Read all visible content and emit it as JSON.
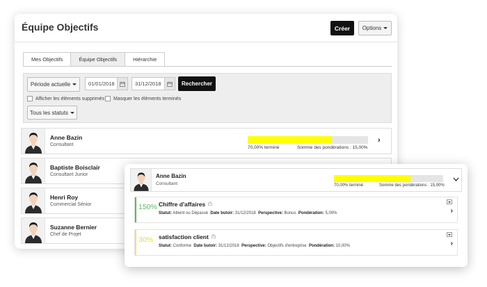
{
  "header": {
    "title": "Équipe Objectifs",
    "create_label": "Créer",
    "options_label": "Options"
  },
  "tabs": [
    {
      "label": "Mes Objectifs",
      "active": false
    },
    {
      "label": "Équipe Objectifs",
      "active": true
    },
    {
      "label": "Hiérarchie",
      "active": false
    }
  ],
  "filters": {
    "period_label": "Période actuelle",
    "date_from": "01/01/2018",
    "date_to": "31/12/2018",
    "search_label": "Rechercher",
    "show_deleted_label": "Afficher les éléments supprimés",
    "hide_finished_label": "Masquer les éléments terminés",
    "status_label": "Tous les statuts"
  },
  "people": [
    {
      "name": "Anne Bazin",
      "role": "Consultant",
      "progress": 0.7,
      "progress_label": "70,00% terminé",
      "weight_label": "Somme des pondérations : 15,00%"
    },
    {
      "name": "Baptiste Boisclair",
      "role": "Consultant Junior"
    },
    {
      "name": "Henri Roy",
      "role": "Commercial Sénior"
    },
    {
      "name": "Suzanne Bernier",
      "role": "Chef de Projet"
    }
  ],
  "detail": {
    "name": "Anne Bazin",
    "role": "Consultant",
    "progress": 0.7,
    "progress_label": "70,00% terminé",
    "weight_label": "Somme des pondérations : 15,00%",
    "objectives": [
      {
        "percent": "150%",
        "title": "Chiffre d'affaires",
        "accent": "#5cb85c",
        "statut_key": "Statut:",
        "statut": "Atteint ou Dépassé",
        "due_key": "Date butoir:",
        "due": "31/12/2018",
        "persp_key": "Perspective:",
        "persp": "Bonus",
        "weight_key": "Pondération:",
        "weight": "5,00%"
      },
      {
        "percent": "30%",
        "title": "satisfaction client",
        "accent": "#f4e46a",
        "statut_key": "Statut:",
        "statut": "Conforme",
        "due_key": "Date butoir:",
        "due": "31/12/2018",
        "persp_key": "Perspective:",
        "persp": "Objectifs d'entreprise",
        "weight_key": "Pondération:",
        "weight": "10,00%"
      }
    ]
  },
  "colors": {
    "progress_fill": "#ffff00",
    "progress_track": "#e5e5e5",
    "primary_button": "#111111"
  }
}
